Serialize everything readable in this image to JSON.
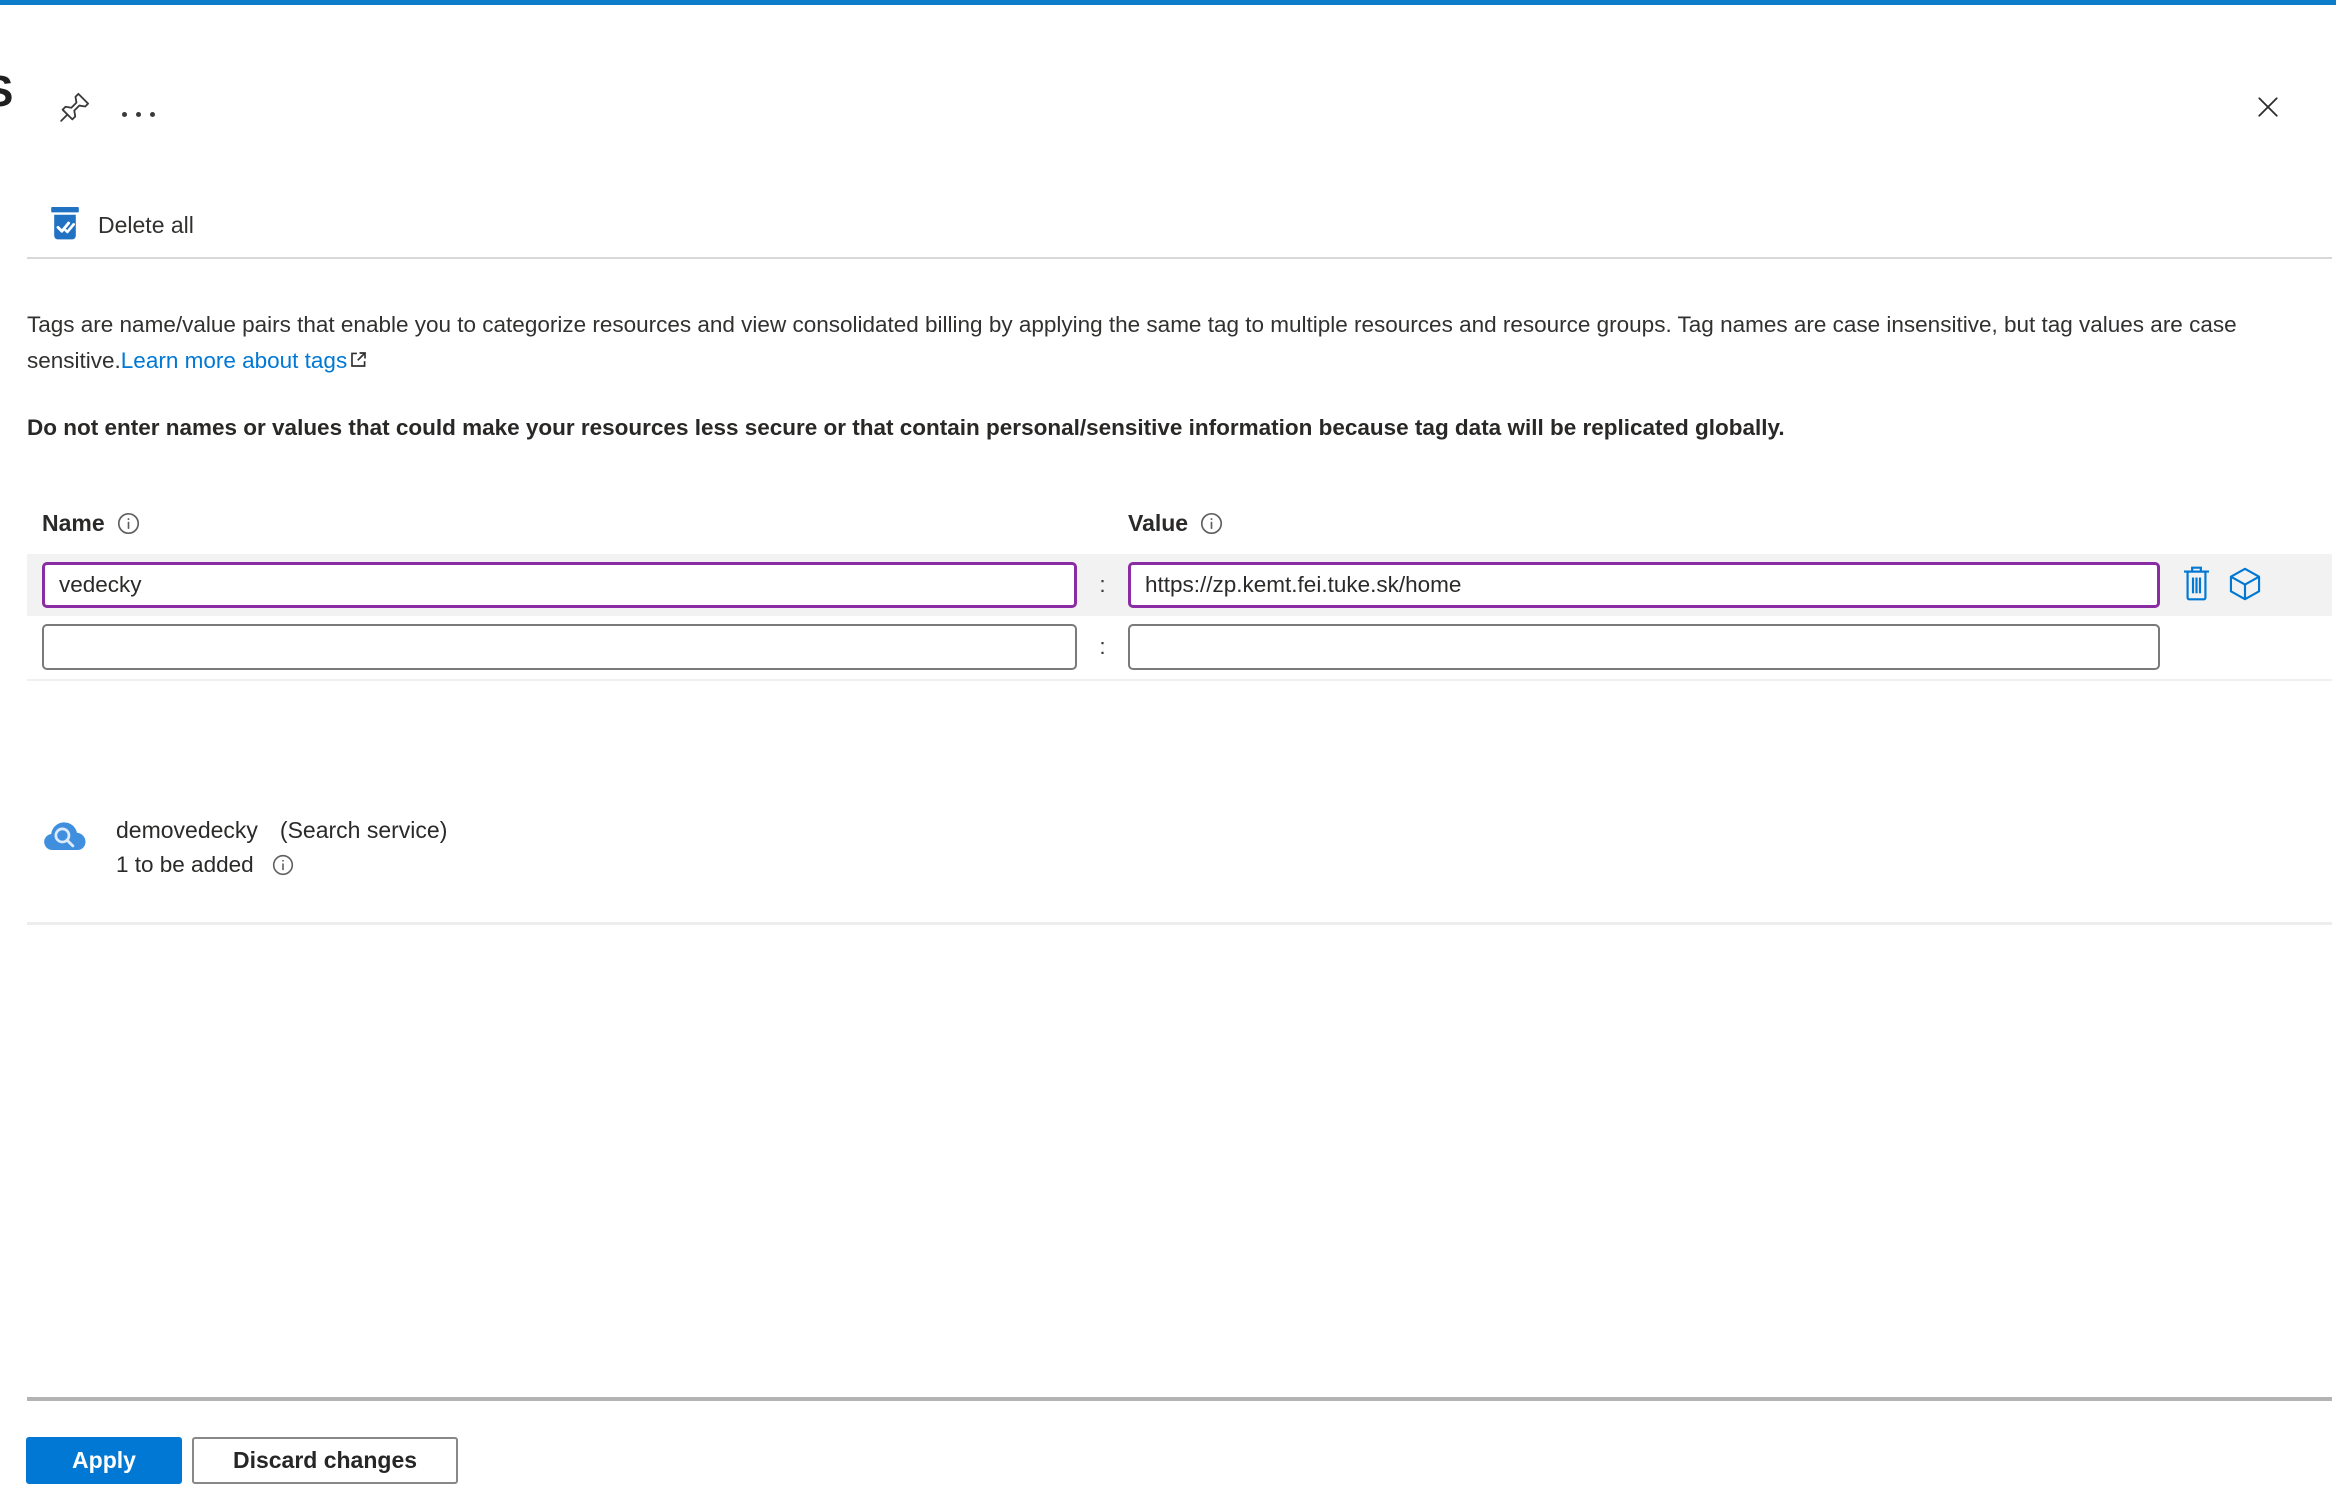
{
  "blade": {
    "partial_title": "S"
  },
  "toolbar": {
    "delete_all": "Delete all"
  },
  "intro": {
    "text": "Tags are name/value pairs that enable you to categorize resources and view consolidated billing by applying the same tag to multiple resources and resource groups. Tag names are case insensitive, but tag values are case sensitive.",
    "link": "Learn more about tags"
  },
  "warning": "Do not enter names or values that could make your resources less secure or that contain personal/sensitive information because tag data will be replicated globally.",
  "tag_editor": {
    "name_header": "Name",
    "value_header": "Value",
    "separator": ":",
    "rows": [
      {
        "name": "vedecky",
        "value": "https://zp.kemt.fei.tuke.sk/home"
      },
      {
        "name": "",
        "value": ""
      }
    ]
  },
  "resource": {
    "name": "demovedecky",
    "type": "(Search service)",
    "pending_count": "1 to be added"
  },
  "footer": {
    "apply": "Apply",
    "discard": "Discard changes"
  },
  "colors": {
    "accent": "#0078d4",
    "modified_border": "#8a2da5",
    "delete_all_icon": "#2272c3"
  },
  "icons": [
    "pin-icon",
    "more-icon",
    "close-icon",
    "delete-all-icon",
    "info-icon",
    "external-link-icon",
    "trash-icon",
    "cube-icon",
    "search-service-icon"
  ]
}
